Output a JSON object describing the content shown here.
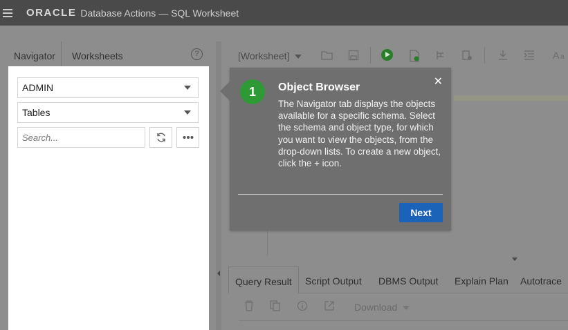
{
  "header": {
    "brand": "ORACLE",
    "title": "Database Actions — SQL Worksheet"
  },
  "navigator": {
    "tabs": [
      "Navigator",
      "Worksheets"
    ],
    "schema": "ADMIN",
    "object_type": "Tables",
    "search_placeholder": "Search..."
  },
  "worksheet": {
    "selector": "[Worksheet]"
  },
  "results": {
    "tabs": [
      "Query Result",
      "Script Output",
      "DBMS Output",
      "Explain Plan",
      "Autotrace"
    ],
    "download_label": "Download"
  },
  "tour": {
    "step": "1",
    "title": "Object Browser",
    "body": "The Navigator tab displays the objects available for a specific schema. Select the schema and object type, for which you want to view the objects, from the drop-down lists. To create a new object, click the + icon.",
    "next_label": "Next"
  },
  "colors": {
    "accent": "#1a63b8",
    "step_badge": "#2e9a36"
  }
}
